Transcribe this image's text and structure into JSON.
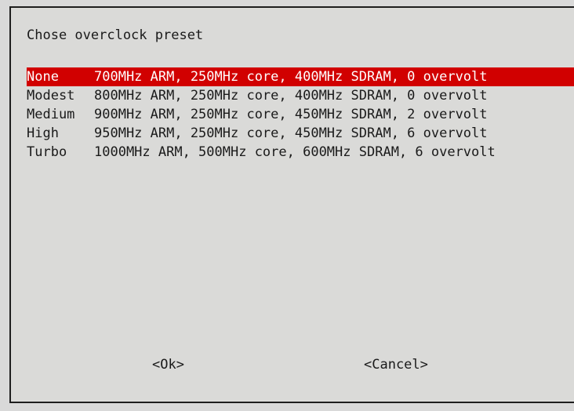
{
  "dialog": {
    "title": "Chose overclock preset",
    "items": [
      {
        "tag": "None",
        "desc": "700MHz ARM, 250MHz core, 400MHz SDRAM, 0 overvolt",
        "selected": true
      },
      {
        "tag": "Modest",
        "desc": "800MHz ARM, 250MHz core, 400MHz SDRAM, 0 overvolt",
        "selected": false
      },
      {
        "tag": "Medium",
        "desc": "900MHz ARM, 250MHz core, 450MHz SDRAM, 2 overvolt",
        "selected": false
      },
      {
        "tag": "High",
        "desc": "950MHz ARM, 250MHz core, 450MHz SDRAM, 6 overvolt",
        "selected": false
      },
      {
        "tag": "Turbo",
        "desc": "1000MHz ARM, 500MHz core, 600MHz SDRAM, 6 overvolt",
        "selected": false
      }
    ],
    "ok_label": "<Ok>",
    "cancel_label": "<Cancel>"
  },
  "colors": {
    "selection": "#d10000",
    "background": "#dadad8",
    "text": "#1a1a1a"
  }
}
